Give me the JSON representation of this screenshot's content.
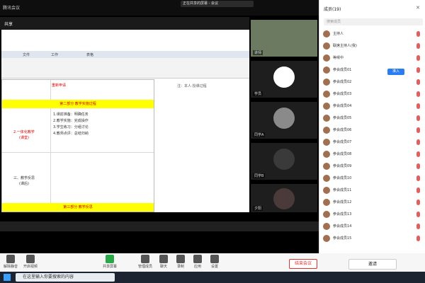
{
  "meeting": {
    "top_left_label": "腾讯会议",
    "title_pill": "正在共享的屏幕 - 会议",
    "share_header": "共享"
  },
  "shared_screen": {
    "tabs": [
      "文件",
      "工作",
      "表格"
    ],
    "row1_text": "重新申请",
    "yellow_bar_1": "第二部分 教学实施过程",
    "section2_label": "2.一体化教学",
    "section2_sub": "(课堂)",
    "section3_label": "三、教学反思",
    "section3_sub": "(课后)",
    "yellow_bar_2": "第三部分 教学反思",
    "cell_lines": [
      "1.课前准备：明确任务",
      "2.教学实施：完成操作",
      "3.学生练习：分组讨论",
      "4.教师点评：总结归纳"
    ],
    "side_note": "注：本人·授课过程"
  },
  "videos": [
    {
      "label": "讲师"
    },
    {
      "label": "学员"
    },
    {
      "label": "同学A"
    },
    {
      "label": "同学B"
    },
    {
      "label": "夕阳"
    }
  ],
  "panel": {
    "title": "成员(19)",
    "search_placeholder": "搜索成员",
    "admit_label": "准入",
    "participants": [
      {
        "name": "主持人"
      },
      {
        "name": "联席主持人(我)"
      },
      {
        "name": "等候中"
      },
      {
        "name": "参会成员01"
      },
      {
        "name": "参会成员02"
      },
      {
        "name": "参会成员03"
      },
      {
        "name": "参会成员04"
      },
      {
        "name": "参会成员05"
      },
      {
        "name": "参会成员06"
      },
      {
        "name": "参会成员07"
      },
      {
        "name": "参会成员08"
      },
      {
        "name": "参会成员09"
      },
      {
        "name": "参会成员10"
      },
      {
        "name": "参会成员11"
      },
      {
        "name": "参会成员12"
      },
      {
        "name": "参会成员13"
      },
      {
        "name": "参会成员14"
      },
      {
        "name": "参会成员15"
      }
    ]
  },
  "toolbar": {
    "buttons": [
      "解除静音",
      "开启视频",
      "共享屏幕",
      "管理成员",
      "聊天",
      "录制",
      "应用",
      "设置"
    ],
    "leave_label": "结束会议",
    "invite_label": "邀请"
  },
  "taskbar": {
    "search_placeholder": "在这里输入你要搜索的内容"
  }
}
